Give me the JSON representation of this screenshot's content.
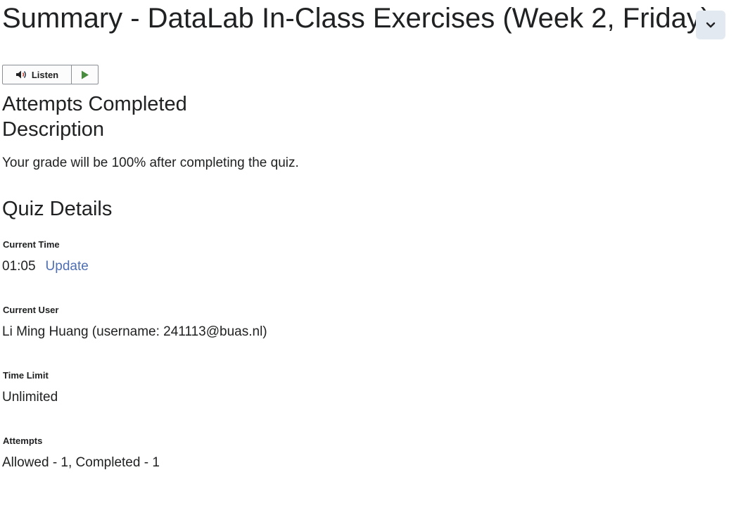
{
  "page": {
    "title": "Summary - DataLab In-Class Exercises (Week 2, Friday)",
    "menu_icon": "chevron-down-icon"
  },
  "listen": {
    "label": "Listen",
    "speaker_icon": "speaker-icon",
    "play_icon": "play-icon",
    "play_color": "#4a8c3f"
  },
  "sections": {
    "attempts_completed": "Attempts Completed",
    "description_heading": "Description",
    "description_text": "Your grade will be 100% after completing the quiz.",
    "quiz_details_heading": "Quiz Details"
  },
  "details": {
    "current_time": {
      "label": "Current Time",
      "value": "01:05",
      "update_link": "Update"
    },
    "current_user": {
      "label": "Current User",
      "value": "Li Ming Huang (username: 241113@buas.nl)"
    },
    "time_limit": {
      "label": "Time Limit",
      "value": "Unlimited"
    },
    "attempts": {
      "label": "Attempts",
      "value": "Allowed - 1, Completed - 1"
    }
  },
  "colors": {
    "link": "#4f6fb3",
    "menu_button_bg": "#e3e9f1",
    "text": "#202122"
  }
}
